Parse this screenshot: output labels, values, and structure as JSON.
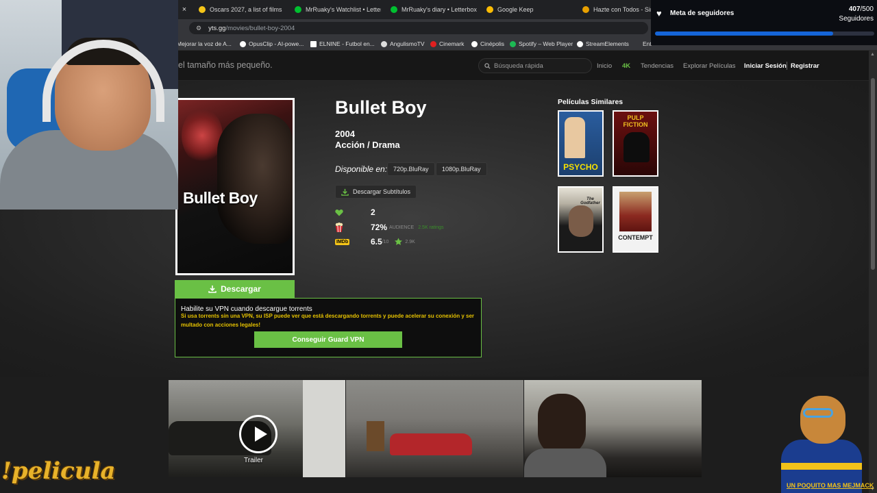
{
  "browser": {
    "tabs": [
      {
        "label": "Oscars 2027, a list of films",
        "color": "#f5c518"
      },
      {
        "label": "MrRuaky's Watchlist • Letterb",
        "color": "#00c030"
      },
      {
        "label": "MrRuaky's diary • Letterboxd",
        "color": "#00c030"
      },
      {
        "label": "Google Keep",
        "color": "#fbbc04"
      },
      {
        "label": "Hazte con Todos - Simul",
        "color": "#e8a000"
      }
    ],
    "close_glyph": "×",
    "url_domain": "yts.gg",
    "url_path": "/movies/bullet-boy-2004",
    "bookmarks": [
      {
        "label": "Mejorar la voz de A...",
        "color": "#aaaaaa"
      },
      {
        "label": "OpusClip - AI-powe...",
        "color": "#ffffff"
      },
      {
        "label": "ELNINE - Futbol en...",
        "color": "#ffffff"
      },
      {
        "label": "AngulismoTV",
        "color": "#dddddd"
      },
      {
        "label": "Cinemark",
        "color": "#e02020"
      },
      {
        "label": "Cinépolis",
        "color": "#ffffff"
      },
      {
        "label": "Spotify – Web Player",
        "color": "#1db954"
      },
      {
        "label": "StreamElements",
        "color": "#ffffff"
      },
      {
        "label": "Ent",
        "color": "#aaaaaa"
      }
    ]
  },
  "site": {
    "slogan": "el tamaño más pequeño.",
    "search_placeholder": "Búsqueda rápida",
    "nav": {
      "inicio": "Inicio",
      "k4": "4K",
      "tendencias": "Tendencias",
      "explorar": "Explorar Películas",
      "login": "Iniciar Sesión",
      "register": "Registrar"
    }
  },
  "movie": {
    "poster_title": "Bullet Boy",
    "title": "Bullet Boy",
    "year": "2004",
    "genres": "Acción / Drama",
    "available_label": "Disponible en:",
    "qualities": [
      "720p.BluRay",
      "1080p.BluRay"
    ],
    "subtitles_label": "Descargar Subtítulos",
    "likes": "2",
    "audience_pct": "72%",
    "audience_label": "AUDIENCE",
    "audience_ratings": "2.5K ratings",
    "imdb_badge": "IMDb",
    "imdb_score": "6.5",
    "imdb_max": "/10",
    "imdb_votes": "2.9K",
    "download_label": "Descargar"
  },
  "similar": {
    "title": "Películas Similares",
    "films": [
      {
        "label": "PSYCHO",
        "color": "#f5e000",
        "bg": "#2a5d9e"
      },
      {
        "label": "PULP FICTION",
        "color": "#f0c020",
        "bg": "#6b1010"
      },
      {
        "label": "The Godfather",
        "color": "#e8d8b0",
        "bg": "#1a1a1a"
      },
      {
        "label": "CONTEMPT",
        "color": "#1a1a1a",
        "bg": "#f2f2f2"
      }
    ]
  },
  "vpn": {
    "heading": "Habilite su VPN cuando descargue torrents",
    "text": "Si usa torrents sin una VPN, su ISP puede ver que está descargando torrents y puede acelerar su conexión y ser multado con acciones legales!",
    "button": "Conseguir Guard VPN"
  },
  "trailer_label": "Trailer",
  "stream": {
    "followers_title": "Meta de seguidores",
    "followers_current": "407",
    "followers_goal": "/500",
    "followers_unit": "Seguidores",
    "followers_progress": 0.814,
    "command": "!pelicula",
    "mascot_label": "UN POQUITO MAS MEJMACK"
  },
  "colors": {
    "accent": "#6ac045",
    "vpn_text": "#e6c200",
    "progress": "#1565d8"
  }
}
